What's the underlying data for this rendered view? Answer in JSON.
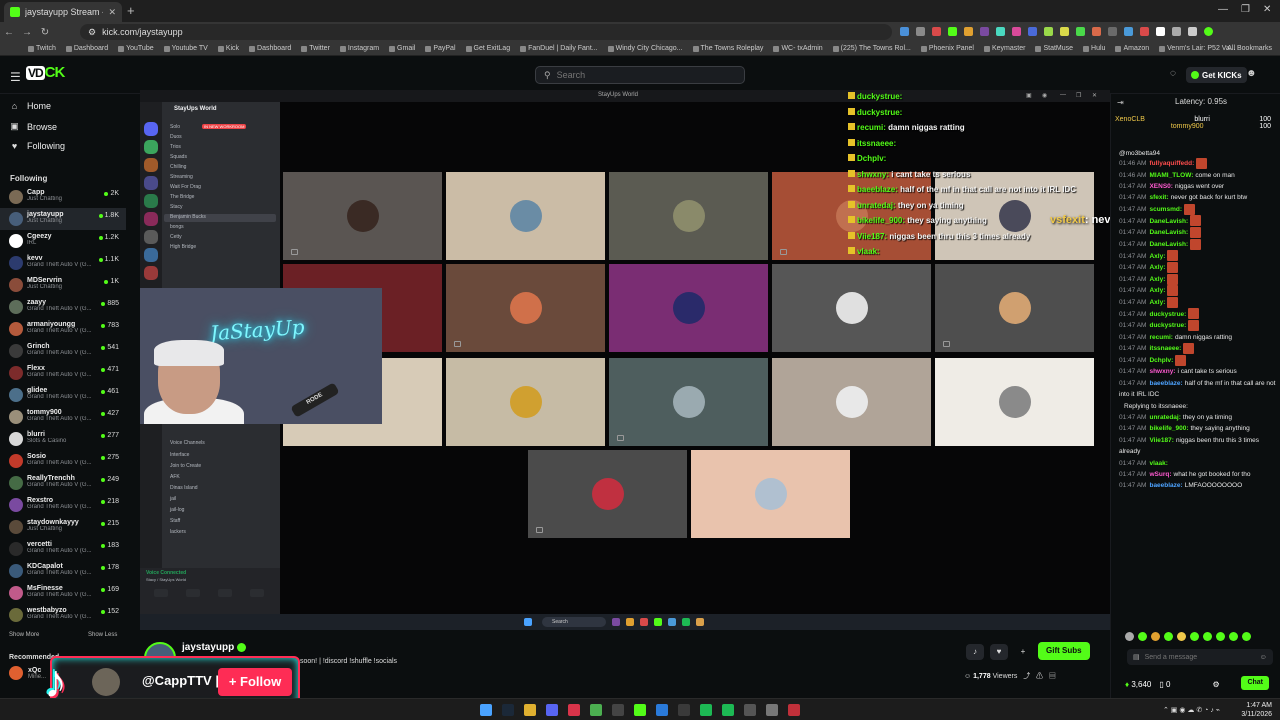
{
  "browser": {
    "tab_title": "jaystayupp Stream - Watch Liv",
    "url": "kick.com/jaystayupp",
    "bookmarks": [
      "Twitch",
      "Dashboard",
      "YouTube",
      "Youtube TV",
      "Kick",
      "Dashboard",
      "Twitter",
      "Instagram",
      "Gmail",
      "PayPal",
      "Get ExitLag",
      "FanDuel | Daily Fant...",
      "Windy City Chicago...",
      "The Towns Roleplay",
      "WC- txAdmin",
      "(225) The Towns Rol...",
      "Phoenix Panel",
      "Keymaster",
      "StatMuse",
      "Hulu",
      "Amazon",
      "Venm's Lair: P52 Va..."
    ],
    "all_bookmarks": "All Bookmarks"
  },
  "header": {
    "logo_vd": "VD",
    "logo_text": "CK",
    "search_placeholder": "Search",
    "get_kicks": "Get KICKs"
  },
  "sidebar": {
    "nav": [
      {
        "label": "Home",
        "icon": "home-icon",
        "glyph": "⌂"
      },
      {
        "label": "Browse",
        "icon": "browse-icon",
        "glyph": "▣"
      },
      {
        "label": "Following",
        "icon": "heart-icon",
        "glyph": "♥"
      }
    ],
    "following_title": "Following",
    "following": [
      {
        "name": "Capp",
        "category": "Just Chatting",
        "viewers": "2K",
        "color": "#7a6a55"
      },
      {
        "name": "jaystayupp",
        "category": "Just Chatting",
        "viewers": "1.8K",
        "color": "#475e7a"
      },
      {
        "name": "Cgeezy",
        "category": "IRL",
        "viewers": "1.2K",
        "color": "#ffffff"
      },
      {
        "name": "kevv",
        "category": "Grand Theft Auto V (G...",
        "viewers": "1.1K",
        "color": "#2c3b6e"
      },
      {
        "name": "MDServrin",
        "category": "Just Chatting",
        "viewers": "1K",
        "color": "#8a4c3a"
      },
      {
        "name": "zaayy",
        "category": "Grand Theft Auto V (G...",
        "viewers": "885",
        "color": "#5d6d5a"
      },
      {
        "name": "armaniyoungg",
        "category": "Grand Theft Auto V (G...",
        "viewers": "783",
        "color": "#b45a3c"
      },
      {
        "name": "Grinch",
        "category": "Grand Theft Auto V (G...",
        "viewers": "541",
        "color": "#3a3a3a"
      },
      {
        "name": "Flexx",
        "category": "Grand Theft Auto V (G...",
        "viewers": "471",
        "color": "#7c2b2b"
      },
      {
        "name": "glidee",
        "category": "Grand Theft Auto V (G...",
        "viewers": "461",
        "color": "#4c6f8a"
      },
      {
        "name": "tommy900",
        "category": "Grand Theft Auto V (G...",
        "viewers": "427",
        "color": "#9a8f7a"
      },
      {
        "name": "blurri",
        "category": "Slots & Casino",
        "viewers": "277",
        "color": "#d8d8d8"
      },
      {
        "name": "Sosio",
        "category": "Grand Theft Auto V (G...",
        "viewers": "275",
        "color": "#c23a2a"
      },
      {
        "name": "ReallyTrenchh",
        "category": "Grand Theft Auto V (G...",
        "viewers": "249",
        "color": "#456b45"
      },
      {
        "name": "Rexstro",
        "category": "Grand Theft Auto V (G...",
        "viewers": "218",
        "color": "#7a4aa0"
      },
      {
        "name": "staydownkayyy",
        "category": "Just Chatting",
        "viewers": "215",
        "color": "#5a4a3a"
      },
      {
        "name": "vercetti",
        "category": "Grand Theft Auto V (G...",
        "viewers": "183",
        "color": "#2a2a2a"
      },
      {
        "name": "KDCapalot",
        "category": "Grand Theft Auto V (G...",
        "viewers": "178",
        "color": "#3a5a7a"
      },
      {
        "name": "MsFinesse",
        "category": "Grand Theft Auto V (G...",
        "viewers": "169",
        "color": "#c05a8a"
      },
      {
        "name": "westbabyzo",
        "category": "Grand Theft Auto V (G...",
        "viewers": "152",
        "color": "#6a6a3a"
      }
    ],
    "show_more": "Show More",
    "show_less": "Show Less",
    "recommended_title": "Recommended",
    "recommended": [
      {
        "name": "xQc",
        "category": "Mine..."
      }
    ]
  },
  "video": {
    "window_title": "StayUps World",
    "discord": {
      "server_name": "StayUps World",
      "channels": [
        "Solo",
        "Duos",
        "Trios",
        "Squads",
        "Chilling",
        "Streaming",
        "Wait For Drag",
        "The Bridge",
        "Stacy",
        "Benjamin Bucks",
        "bongs",
        "Cetty",
        "High Bridge"
      ],
      "live_badge": "IN NEW WORKROOM",
      "voice_channels_label": "Voice Channels",
      "lower_channels": [
        "Interface",
        "Join to Create",
        "AFK",
        "Dinas Island",
        "jail",
        "jail-log",
        "Staff",
        "lackers"
      ],
      "voice_connected": "Voice Connected",
      "voice_sub": "Stacy / StayUps World"
    },
    "webcam_neon": "JaStayUp",
    "mic_label": "RODE",
    "tiles": [
      {
        "bg": "#5a5552",
        "av": "#3a2a24"
      },
      {
        "bg": "#cbbca6",
        "av": "#6a8ca5"
      },
      {
        "bg": "#5b5b52",
        "av": "#8a8a6a"
      },
      {
        "bg": "#a64e35",
        "av": "#c07050"
      },
      {
        "bg": "#cfc5b7",
        "av": "#4a4a5a"
      },
      {
        "bg": "#6b2025",
        "av": "#6b2025"
      },
      {
        "bg": "#6a4a3b",
        "av": "#d0704a"
      },
      {
        "bg": "#7a2d73",
        "av": "#2a2a6a"
      },
      {
        "bg": "#565656",
        "av": "#e0e0e0"
      },
      {
        "bg": "#4e4e4e",
        "av": "#d0a070"
      },
      {
        "bg": "#d7cbb7",
        "av": "#d7cbb7"
      },
      {
        "bg": "#c6bba5",
        "av": "#d0a030"
      },
      {
        "bg": "#4e5e5e",
        "av": "#9aaab0"
      },
      {
        "bg": "#b0a498",
        "av": "#e8e8e8"
      },
      {
        "bg": "#efece6",
        "av": "#8a8a8a"
      },
      {
        "bg": "#4b4b4b",
        "av": "#c03040"
      },
      {
        "bg": "#e9c3ad",
        "av": "#b0c0d0"
      }
    ],
    "chat_overlay": [
      {
        "user": "duckystrue:",
        "msg": ""
      },
      {
        "user": "duckystrue:",
        "msg": ""
      },
      {
        "user": "recumi:",
        "msg": "damn niggas ratting"
      },
      {
        "user": "itssnaeee:",
        "msg": ""
      },
      {
        "user": "Dchplv:",
        "msg": ""
      },
      {
        "user": "shwxny:",
        "msg": "i cant take ts serious"
      },
      {
        "user": "baeeblaze:",
        "msg": "half of the mf in that call are not into it IRL IDC"
      },
      {
        "user": "unratedaj:",
        "msg": "they on ya timing"
      },
      {
        "user": "bikelife_900:",
        "msg": "they saying anything"
      },
      {
        "user": "Viie187:",
        "msg": "niggas been thru this 3 times already"
      },
      {
        "user": "vlaak:",
        "msg": ""
      }
    ],
    "overlay_big_user": "vsfexit",
    "overlay_big_msg": ": never got back for kurt btw",
    "taskbar_search": "Search"
  },
  "chat": {
    "latency": "Latency: 0.95s",
    "pinned": [
      {
        "name": "XenoCLB",
        "user2": "blurri",
        "val": "100"
      },
      {
        "name": "",
        "user2": "tommy900",
        "val": "100"
      }
    ],
    "partial_user": "@mo3betta94",
    "messages": [
      {
        "time": "01:46 AM",
        "user": "fullyaquiffedd:",
        "color": "#ff4d4d",
        "msg": "",
        "emote": true
      },
      {
        "time": "01:46 AM",
        "user": "MIAMI_TLOW:",
        "color": "#53fc18",
        "msg": "come on man",
        "emote": false
      },
      {
        "time": "01:47 AM",
        "user": "XENS0:",
        "color": "#ff5ad1",
        "msg": "niggas went over",
        "emote": false
      },
      {
        "time": "01:47 AM",
        "user": "sfexit:",
        "color": "#53fc18",
        "msg": "never got back for kurt btw",
        "emote": false
      },
      {
        "time": "01:47 AM",
        "user": "scumsmd:",
        "color": "#53fc18",
        "msg": "",
        "emote": true
      },
      {
        "time": "01:47 AM",
        "user": "DaneLavish:",
        "color": "#53fc18",
        "msg": "",
        "emote": true
      },
      {
        "time": "01:47 AM",
        "user": "DaneLavish:",
        "color": "#53fc18",
        "msg": "",
        "emote": true
      },
      {
        "time": "01:47 AM",
        "user": "DaneLavish:",
        "color": "#53fc18",
        "msg": "",
        "emote": true
      },
      {
        "time": "01:47 AM",
        "user": "Axly:",
        "color": "#53fc18",
        "msg": "",
        "emote": true
      },
      {
        "time": "01:47 AM",
        "user": "Axly:",
        "color": "#53fc18",
        "msg": "",
        "emote": true
      },
      {
        "time": "01:47 AM",
        "user": "Axly:",
        "color": "#53fc18",
        "msg": "",
        "emote": true
      },
      {
        "time": "01:47 AM",
        "user": "Axly:",
        "color": "#53fc18",
        "msg": "",
        "emote": true
      },
      {
        "time": "01:47 AM",
        "user": "Axly:",
        "color": "#53fc18",
        "msg": "",
        "emote": true
      },
      {
        "time": "01:47 AM",
        "user": "duckystrue:",
        "color": "#53fc18",
        "msg": "",
        "emote": true
      },
      {
        "time": "01:47 AM",
        "user": "duckystrue:",
        "color": "#53fc18",
        "msg": "",
        "emote": true
      },
      {
        "time": "01:47 AM",
        "user": "recumi:",
        "color": "#53fc18",
        "msg": "damn niggas ratting",
        "emote": false
      },
      {
        "time": "01:47 AM",
        "user": "itssnaeee:",
        "color": "#53fc18",
        "msg": "",
        "emote": true
      },
      {
        "time": "01:47 AM",
        "user": "Dchplv:",
        "color": "#53fc18",
        "msg": "",
        "emote": true
      },
      {
        "time": "01:47 AM",
        "user": "shwxny:",
        "color": "#ff5ad1",
        "msg": "i cant take ts serious",
        "emote": false
      },
      {
        "time": "01:47 AM",
        "user": "baeeblaze:",
        "color": "#4da3ff",
        "msg": "half of the mf in that call are not into it IRL IDC",
        "emote": false
      },
      {
        "time": "",
        "user": "",
        "color": "#8d9095",
        "msg": "Replying to itssnaeee:",
        "emote": false
      },
      {
        "time": "01:47 AM",
        "user": "unratedaj:",
        "color": "#53fc18",
        "msg": "they on ya timing",
        "emote": false
      },
      {
        "time": "01:47 AM",
        "user": "bikelife_900:",
        "color": "#53fc18",
        "msg": "they saying anything",
        "emote": false
      },
      {
        "time": "01:47 AM",
        "user": "Viie187:",
        "color": "#53fc18",
        "msg": "niggas been thru this 3 times already",
        "emote": false
      },
      {
        "time": "01:47 AM",
        "user": "vlaak:",
        "color": "#53fc18",
        "msg": "",
        "emote": false
      },
      {
        "time": "01:47 AM",
        "user": "wSurq:",
        "color": "#ff5ad1",
        "msg": "what he got booked for tho",
        "emote": false
      },
      {
        "time": "01:47 AM",
        "user": "baeeblaze:",
        "color": "#4da3ff",
        "msg": "LMFAOOOOOOOO",
        "emote": false
      }
    ],
    "send_placeholder": "Send a message",
    "kicks_balance": "3,640",
    "zero_count": "0",
    "chat_button": "Chat"
  },
  "stream": {
    "streamer": "jaystayupp",
    "title": "soon! | !discord !shuffle !socials",
    "viewers": "1,778",
    "viewers_label": "Viewers",
    "gift_subs": "Gift Subs"
  },
  "tiktok": {
    "handle": "@CappTTV |",
    "follow": "+ Follow"
  },
  "taskbar": {
    "time": "1:47 AM",
    "date": "3/11/2026"
  }
}
